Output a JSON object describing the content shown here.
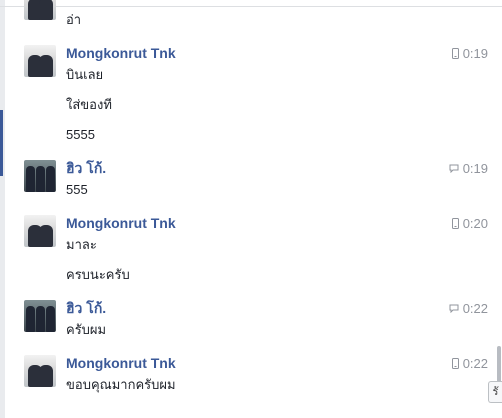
{
  "messages": [
    {
      "sender": "",
      "avatar": "mongkonrut",
      "lines": [
        "อ่า"
      ],
      "time": "",
      "device": ""
    },
    {
      "sender": "Mongkonrut Tnk",
      "avatar": "mongkonrut",
      "lines": [
        "บินเลย",
        "ใส่ของที",
        "5555"
      ],
      "time": "0:19",
      "device": "mobile-icon"
    },
    {
      "sender": "ฮิว โก้.",
      "avatar": "hiw",
      "lines": [
        "555"
      ],
      "time": "0:19",
      "device": "chat-icon"
    },
    {
      "sender": "Mongkonrut Tnk",
      "avatar": "mongkonrut",
      "lines": [
        "มาละ",
        "ครบนะครับ"
      ],
      "time": "0:20",
      "device": "mobile-icon"
    },
    {
      "sender": "ฮิว โก้.",
      "avatar": "hiw",
      "lines": [
        "ครับผม"
      ],
      "time": "0:22",
      "device": "chat-icon"
    },
    {
      "sender": "Mongkonrut Tnk",
      "avatar": "mongkonrut",
      "lines": [
        "ขอบคุณมากครับผม"
      ],
      "time": "0:22",
      "device": "mobile-icon"
    }
  ],
  "corner_tab_label": "รั",
  "colors": {
    "sender": "#3b5998",
    "text": "#1d2129",
    "meta": "#90949c"
  }
}
